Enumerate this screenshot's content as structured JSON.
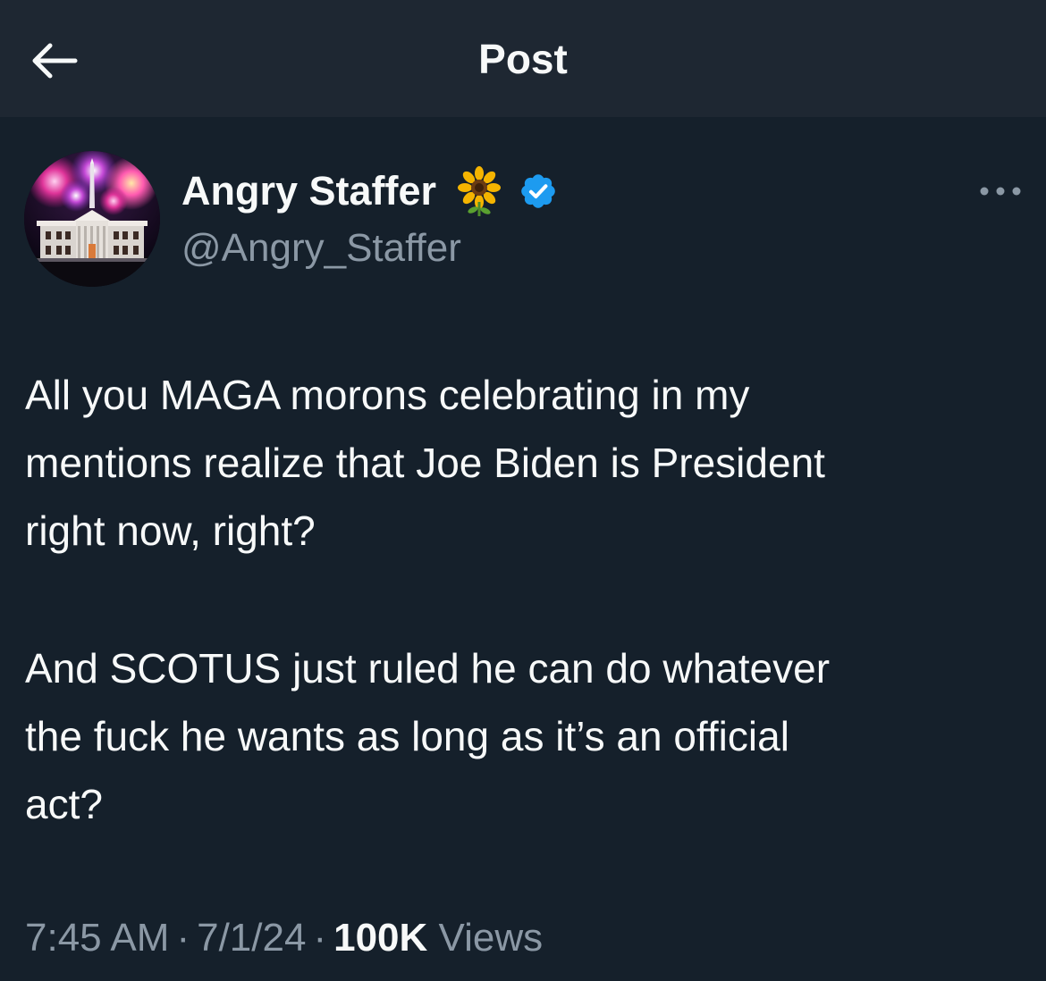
{
  "header": {
    "title": "Post",
    "back_icon": "arrow-left-icon"
  },
  "author": {
    "name": "Angry Staffer",
    "handle": "@Angry_Staffer",
    "emoji": "🌻",
    "verified_icon": "verified-badge-icon",
    "verified_color": "#1d9bf0"
  },
  "post": {
    "paragraphs": [
      {
        "lines": [
          "All you MAGA morons celebrating in my",
          "mentions realize that Joe Biden is President",
          "right now, right?"
        ]
      },
      {
        "lines": [
          "And SCOTUS just ruled he can do whatever",
          "the fuck he wants as long as it’s an official",
          "act?"
        ]
      }
    ]
  },
  "meta": {
    "time": "7:45 AM",
    "separator": "·",
    "date": "7/1/24",
    "views_count": "100K",
    "views_label": "Views"
  },
  "menu_icon": "more-horizontal-icon"
}
